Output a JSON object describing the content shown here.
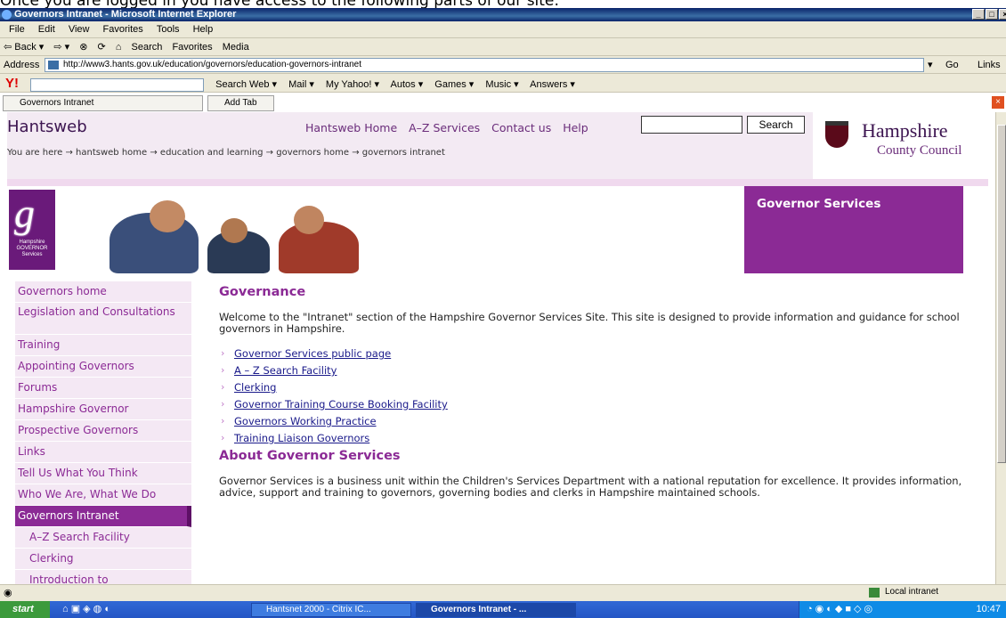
{
  "caption": "Once you are logged in you have access to the following parts of our site:",
  "window": {
    "title": "Governors Intranet - Microsoft Internet Explorer",
    "controls": [
      "_",
      "□",
      "×"
    ]
  },
  "menubar": [
    "File",
    "Edit",
    "View",
    "Favorites",
    "Tools",
    "Help"
  ],
  "toolbar": {
    "back": "⇦ Back ▾",
    "forward": "⇨ ▾",
    "search": "Search",
    "favorites": "Favorites",
    "media": "Media"
  },
  "address": {
    "label": "Address",
    "url": "http://www3.hants.gov.uk/education/governors/education-governors-intranet",
    "go": "Go",
    "links": "Links"
  },
  "yahoo": {
    "logo": "Y!",
    "search_web": "Search Web ▾",
    "items": [
      "Mail ▾",
      "My Yahoo! ▾",
      "Autos ▾",
      "Games ▾",
      "Music ▾",
      "Answers ▾"
    ]
  },
  "tabs": {
    "current": "Governors Intranet",
    "add": "Add Tab"
  },
  "site": {
    "title": "Hantsweb",
    "nav": [
      "Hantsweb Home",
      "A–Z Services",
      "Contact us",
      "Help"
    ],
    "search_button": "Search",
    "council_name": "Hampshire",
    "council_sub": "County Council",
    "breadcrumb": "You are here → hantsweb home → education and learning → governors home → governors intranet",
    "logo_letter": "g",
    "logo_text": "Hampshire GOVERNOR Services",
    "banner_title": "Governor Services"
  },
  "sidebar": [
    {
      "label": "Governors home"
    },
    {
      "label": "Legislation and Consultations"
    },
    {
      "label": "Training"
    },
    {
      "label": "Appointing Governors"
    },
    {
      "label": "Forums"
    },
    {
      "label": "Hampshire Governor"
    },
    {
      "label": "Prospective Governors"
    },
    {
      "label": "Links"
    },
    {
      "label": "Tell Us What You Think"
    },
    {
      "label": "Who We Are, What We Do"
    },
    {
      "label": "Governors Intranet"
    },
    {
      "label": "A–Z Search Facility"
    },
    {
      "label": "Clerking"
    },
    {
      "label": "Introduction to"
    }
  ],
  "content": {
    "heading1": "Governance",
    "intro": "Welcome to the \"Intranet\" section of the Hampshire Governor Services Site.  This site is designed to provide information and guidance for school governors in Hampshire.",
    "links": [
      "Governor Services public page",
      "A – Z Search Facility",
      "Clerking",
      "Governor Training Course Booking Facility",
      "Governors Working Practice",
      "Training Liaison Governors"
    ],
    "heading2": "About Governor Services",
    "about": "Governor Services is a business unit within the Children's Services Department with a national reputation for excellence. It provides information, advice, support and training to governors, governing bodies and clerks in Hampshire maintained schools."
  },
  "status": {
    "zone": "Local intranet"
  },
  "taskbar": {
    "start": "start",
    "buttons": [
      "Hantsnet 2000 - Citrix IC...",
      "Governors Intranet - ..."
    ],
    "clock": "10:47"
  }
}
